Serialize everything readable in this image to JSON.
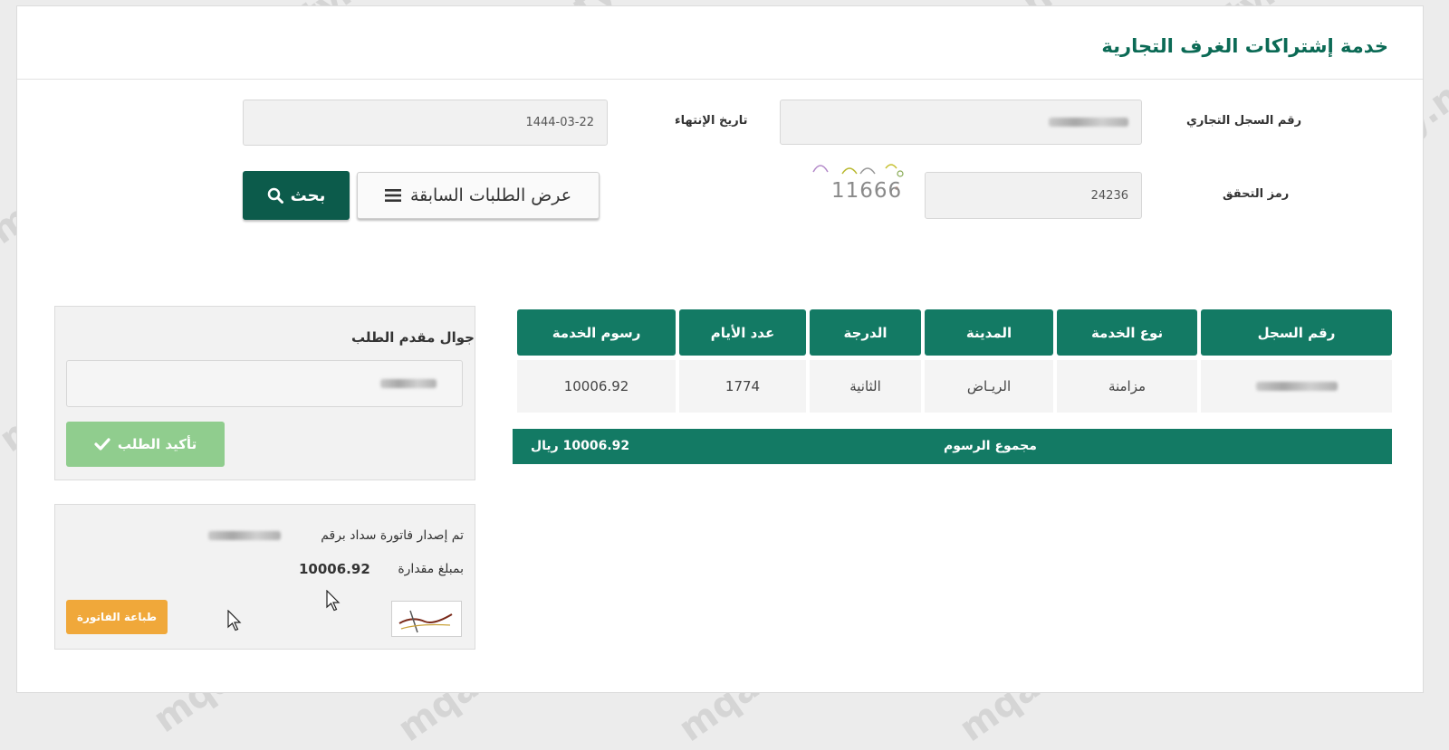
{
  "page": {
    "title": "خدمة إشتراكات الغرف التجارية"
  },
  "form": {
    "cr_number_label": "رقم السجل التجاري",
    "expiry_label": "تاريخ الإنتهاء",
    "expiry_value": "1444-03-22",
    "captcha_label": "رمز التحقق",
    "captcha_value": "24236",
    "captcha_image_text": "11666",
    "previous_requests_label": "عرض الطلبات السابقة",
    "search_label": "بحث"
  },
  "table": {
    "headers": [
      "رقم السجل",
      "نوع الخدمة",
      "المدينة",
      "الدرجة",
      "عدد الأيام",
      "رسوم الخدمة"
    ],
    "row": {
      "service_type": "مزامنة",
      "city": "الريـاض",
      "grade": "الثانية",
      "days": "1774",
      "fee": "10006.92"
    },
    "total_label": "مجموع الرسوم",
    "total_value": "10006.92 ريال"
  },
  "applicant": {
    "mobile_label": "جوال مقدم الطلب",
    "confirm_label": "تأكيد الطلب"
  },
  "invoice": {
    "issued_text": "تم إصدار فاتورة سداد برقم",
    "amount_label": "بمبلغ مقدارة",
    "amount_value": "10006.92",
    "print_label": "طباعة الفاتورة",
    "logo_text": "سداد"
  },
  "watermark": {
    "text": "mqalaty.net"
  },
  "colors": {
    "brand_green": "#137a64",
    "dark_green": "#0c5b4b",
    "confirm_green": "#90cd8e",
    "print_orange": "#f0a83a"
  }
}
